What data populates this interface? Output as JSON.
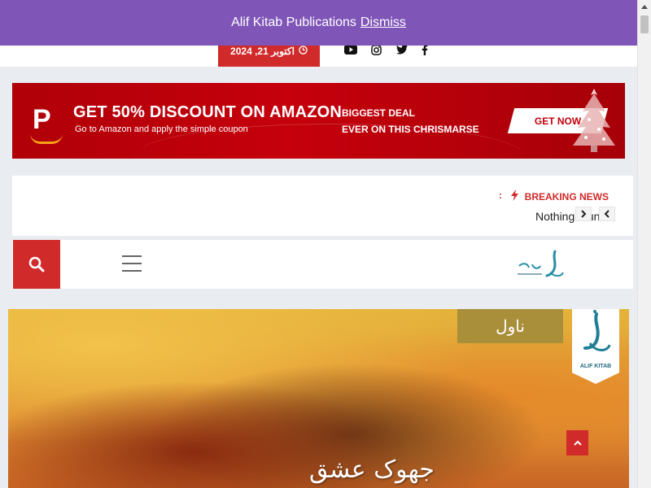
{
  "notice": {
    "text": "Alif Kitab Publications",
    "dismiss_label": "Dismiss"
  },
  "topbar": {
    "date": "اکتوبر 21, 2024",
    "social": [
      "facebook-icon",
      "twitter-icon",
      "instagram-icon",
      "youtube-icon"
    ]
  },
  "ad": {
    "headline": "GET 50% DISCOUNT ON AMAZON",
    "subline": "Go to Amazon and apply the simple coupon",
    "deal_line1": "BIGGEST DEAL",
    "deal_line2": "EVER ON THIS CHRISMARSE",
    "cta_label": "GET NOW",
    "logo_letter": "P"
  },
  "breaking": {
    "label": "BREAKING NEWS",
    "separator": ":",
    "text": "Nothing found"
  },
  "hero": {
    "genre": "ناول",
    "publisher": "ALIF KITAB",
    "title": "جھوک عشق"
  },
  "colors": {
    "notice_bg": "#7f55b8",
    "accent_red": "#d12a2a",
    "page_bg": "#e9ecf1",
    "ad_red": "#c5000c"
  }
}
